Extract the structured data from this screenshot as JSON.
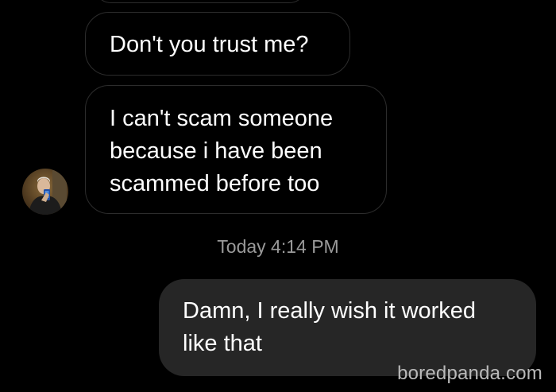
{
  "conversation": {
    "incoming_messages": [
      {
        "lines": [
          "Don't you trust me?"
        ]
      },
      {
        "lines": [
          "I can't scam someone",
          "because i have been",
          "scammed before too"
        ]
      }
    ],
    "timestamp": "Today 4:14 PM",
    "outgoing_message": {
      "lines": [
        "Damn, I really wish it worked",
        "like that"
      ]
    },
    "avatar_icon": "person-photo-avatar"
  },
  "watermark": "boredpanda.com",
  "colors": {
    "background": "#000000",
    "incoming_border": "#2c2c2c",
    "outgoing_bubble": "#262626",
    "timestamp_text": "#9a9a9a"
  }
}
